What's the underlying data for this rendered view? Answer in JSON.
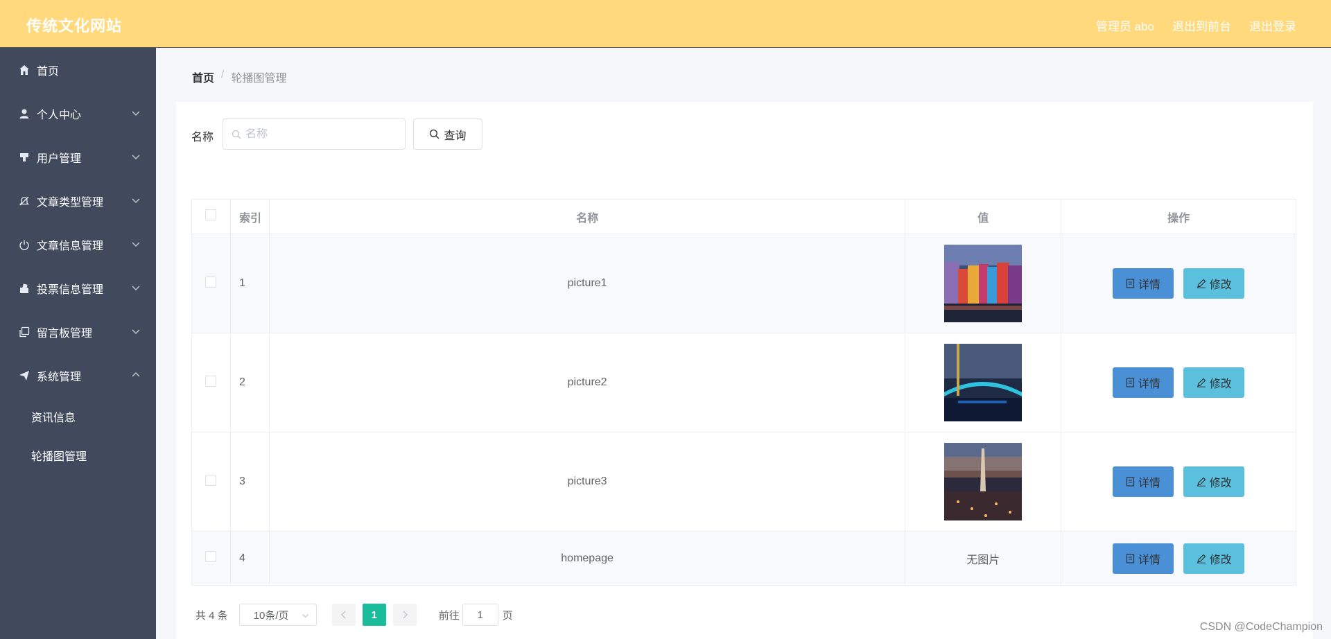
{
  "header": {
    "title": "传统文化网站",
    "admin_label": "管理员 abo",
    "to_front": "退出到前台",
    "logout": "退出登录"
  },
  "sidebar": {
    "items": [
      {
        "label": "首页",
        "icon": "home-icon",
        "expandable": false
      },
      {
        "label": "个人中心",
        "icon": "user-icon",
        "expandable": true
      },
      {
        "label": "用户管理",
        "icon": "user-manage-icon",
        "expandable": true
      },
      {
        "label": "文章类型管理",
        "icon": "bell-off-icon",
        "expandable": true
      },
      {
        "label": "文章信息管理",
        "icon": "power-icon",
        "expandable": true
      },
      {
        "label": "投票信息管理",
        "icon": "vote-icon",
        "expandable": true
      },
      {
        "label": "留言板管理",
        "icon": "copy-icon",
        "expandable": true
      },
      {
        "label": "系统管理",
        "icon": "send-icon",
        "expandable": true,
        "expanded": true
      }
    ],
    "sub_items": [
      {
        "label": "资讯信息"
      },
      {
        "label": "轮播图管理",
        "active": true
      }
    ]
  },
  "breadcrumb": {
    "home": "首页",
    "separator": "/",
    "current": "轮播图管理"
  },
  "search": {
    "label": "名称",
    "placeholder": "名称",
    "value": "",
    "button": "查询"
  },
  "table": {
    "headers": {
      "index": "索引",
      "name": "名称",
      "value": "值",
      "ops": "操作"
    },
    "rows": [
      {
        "index": "1",
        "name": "picture1",
        "value_type": "image",
        "image": "colorful-buildings-waterfront"
      },
      {
        "index": "2",
        "name": "picture2",
        "value_type": "image",
        "image": "lit-bridge-night"
      },
      {
        "index": "3",
        "name": "picture3",
        "value_type": "image",
        "image": "city-tower-night"
      },
      {
        "index": "4",
        "name": "homepage",
        "value_type": "text",
        "value_text": "无图片"
      }
    ],
    "detail_label": "详情",
    "edit_label": "修改"
  },
  "pagination": {
    "total": "共 4 条",
    "page_size": "10条/页",
    "current_page": "1",
    "goto_label": "前往",
    "goto_value": "1",
    "page_suffix": "页"
  },
  "watermark": "CSDN @CodeChampion",
  "colors": {
    "header_bg": "#ffd97c",
    "sidebar_bg": "#414a5c",
    "detail_btn": "#4a90d6",
    "edit_btn": "#5bc0de",
    "active_page": "#1abc9c"
  }
}
